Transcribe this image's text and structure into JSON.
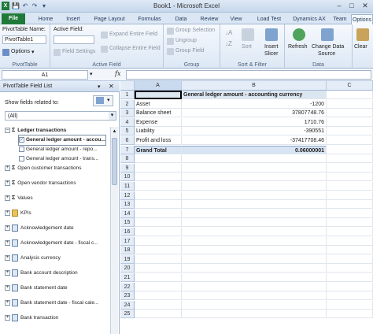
{
  "window": {
    "title": "Book1 - Microsoft Excel",
    "controls": [
      "–",
      "□",
      "✕"
    ]
  },
  "tabs": [
    "File",
    "Home",
    "Insert",
    "Page Layout",
    "Formulas",
    "Data",
    "Review",
    "View",
    "Load Test",
    "Dynamics AX",
    "Team",
    "Options"
  ],
  "ribbon": {
    "pivottable": {
      "name_label": "PivotTable Name:",
      "name_value": "PivotTable1",
      "options": "Options",
      "group_label": "PivotTable"
    },
    "active_field": {
      "label": "Active Field:",
      "value": "",
      "field_settings": "Field Settings",
      "expand": "Expand Entire Field",
      "collapse": "Collapse Entire Field",
      "group_label": "Active Field"
    },
    "group": {
      "group_selection": "Group Selection",
      "ungroup": "Ungroup",
      "group_field": "Group Field",
      "group_label": "Group"
    },
    "sort": {
      "sort_label": "Sort",
      "insert_slicer": "Insert",
      "insert_slicer2": "Slicer",
      "group_label": "Sort & Filter"
    },
    "data": {
      "refresh": "Refresh",
      "change_source": "Change Data",
      "change_source2": "Source",
      "clear": "Clear",
      "group_label": "Data"
    }
  },
  "formula_bar": {
    "name_box": "A1",
    "fx": "fx",
    "value": ""
  },
  "field_list": {
    "title": "PivotTable Field List",
    "show_fields_label": "Show fields related to:",
    "show_fields_value": "(All)",
    "items": [
      {
        "kind": "sigma",
        "label": "Ledger transactions",
        "expander": "–"
      },
      {
        "kind": "checked",
        "label": "General ledger amount - accou..."
      },
      {
        "kind": "unchecked",
        "label": "General ledger amount - repo..."
      },
      {
        "kind": "unchecked",
        "label": "General ledger amount - trans..."
      },
      {
        "kind": "sigma",
        "label": "Open customer transactions",
        "expander": "+"
      },
      {
        "kind": "sigma",
        "label": "Open vendor transactions",
        "expander": "+"
      },
      {
        "kind": "sigma",
        "label": "Values",
        "expander": "+"
      },
      {
        "kind": "kpi",
        "label": "KPIs",
        "expander": "+"
      },
      {
        "kind": "table",
        "label": "Acknowledgement date",
        "expander": "+"
      },
      {
        "kind": "table",
        "label": "Acknowledgement date - fiscal c...",
        "expander": "+"
      },
      {
        "kind": "table",
        "label": "Analysis currency",
        "expander": "+"
      },
      {
        "kind": "table",
        "label": "Bank account description",
        "expander": "+"
      },
      {
        "kind": "table",
        "label": "Bank statement date",
        "expander": "+"
      },
      {
        "kind": "table",
        "label": "Bank statement date - fiscal cale...",
        "expander": "+"
      },
      {
        "kind": "table",
        "label": "Bank transaction",
        "expander": "+"
      }
    ]
  },
  "sheet": {
    "columns": [
      "A",
      "B",
      "C"
    ],
    "rows": [
      {
        "num": "1",
        "a": "",
        "b": "General ledger amount - accounting currency"
      },
      {
        "num": "2",
        "a": "Asset",
        "b": "-1200"
      },
      {
        "num": "3",
        "a": "Balance sheet",
        "b": "37807748.76"
      },
      {
        "num": "4",
        "a": "Expense",
        "b": "1710.76"
      },
      {
        "num": "5",
        "a": "Liability",
        "b": "-390551"
      },
      {
        "num": "6",
        "a": "Profit and loss",
        "b": "-37417708.46"
      },
      {
        "num": "7",
        "a": "Grand Total",
        "b": "0.06000001"
      },
      {
        "num": "8",
        "a": "",
        "b": ""
      },
      {
        "num": "9",
        "a": "",
        "b": ""
      },
      {
        "num": "10",
        "a": "",
        "b": ""
      },
      {
        "num": "11",
        "a": "",
        "b": ""
      },
      {
        "num": "12",
        "a": "",
        "b": ""
      },
      {
        "num": "13",
        "a": "",
        "b": ""
      },
      {
        "num": "14",
        "a": "",
        "b": ""
      },
      {
        "num": "15",
        "a": "",
        "b": ""
      },
      {
        "num": "16",
        "a": "",
        "b": ""
      },
      {
        "num": "17",
        "a": "",
        "b": ""
      },
      {
        "num": "18",
        "a": "",
        "b": ""
      },
      {
        "num": "19",
        "a": "",
        "b": ""
      },
      {
        "num": "20",
        "a": "",
        "b": ""
      },
      {
        "num": "21",
        "a": "",
        "b": ""
      },
      {
        "num": "22",
        "a": "",
        "b": ""
      },
      {
        "num": "23",
        "a": "",
        "b": ""
      },
      {
        "num": "24",
        "a": "",
        "b": ""
      },
      {
        "num": "25",
        "a": "",
        "b": ""
      }
    ]
  },
  "colors": {
    "file_tab": "#1f7a3a",
    "header_row": "#dce6f1",
    "grand_total": "#d8e4f3",
    "selected_cell": "#000000"
  }
}
